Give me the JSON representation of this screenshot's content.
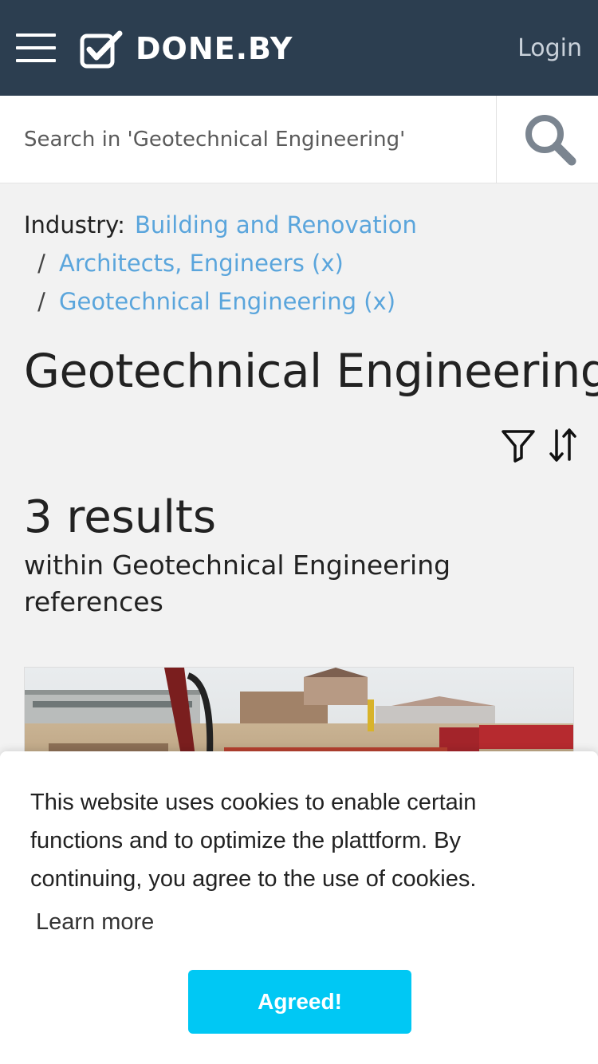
{
  "header": {
    "brand": "DONE.BY",
    "login_label": "Login",
    "colors": {
      "background": "#2c3e50",
      "text": "#ffffff"
    }
  },
  "search": {
    "placeholder": "Search in 'Geotechnical Engineering'",
    "value": ""
  },
  "breadcrumb": {
    "label": "Industry:",
    "items": [
      {
        "label": "Building and Renovation"
      },
      {
        "label": "Architects, Engineers (x)"
      },
      {
        "label": "Geotechnical Engineering (x)"
      }
    ],
    "separator": "/",
    "link_color": "#5aa5dc"
  },
  "main": {
    "title": "Geotechnical Engineering",
    "results_count": "3 results",
    "results_context": "within Geotechnical Engineering references"
  },
  "icons": {
    "menu": "hamburger-icon",
    "logo": "checkbox-logo-icon",
    "search": "search-icon",
    "filter": "filter-icon",
    "sort": "sort-icon"
  },
  "cookie_banner": {
    "message": "This website uses cookies to enable certain functions and to optimize the plattform. By continuing, you agree to the use of cookies.",
    "learn_more": "Learn more",
    "accept_label": "Agreed!",
    "accept_color": "#00c8f4"
  }
}
